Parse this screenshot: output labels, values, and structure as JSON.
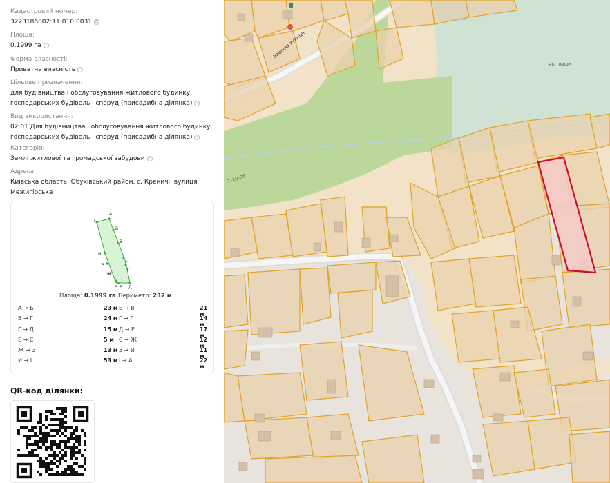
{
  "parcel": {
    "cadastral_label": "Кадастровий номер:",
    "cadastral_value": "3223186802:11:010:0031",
    "area_label": "Площа:",
    "area_value": "0.1999 га",
    "ownership_label": "Форма власності:",
    "ownership_value": "Приватна власність",
    "purpose_label": "Цільове призначення:",
    "purpose_value": "для будівництва і обслуговування житлового будинку, господарських будівель і споруд (присадибна ділянка)",
    "usage_label": "Вид використання:",
    "usage_value": "02.01 Для будівництва і обслуговування житлового будинку, господарських будівель і споруд (присадибна ділянка)",
    "category_label": "Категорія:",
    "category_value": "Землі житлової та громадської забудови",
    "address_label": "Адреса:",
    "address_value": "Київська область, Обухівський район, с. Креничі, вулиця Межигірська"
  },
  "shape_card": {
    "vertex_labels": [
      "А",
      "Б",
      "В",
      "Г",
      "Ґ",
      "Д",
      "Е",
      "Є",
      "Ж",
      "З",
      "И",
      "І"
    ],
    "area_label": "Площа:",
    "area_value": "0.1999 га",
    "perimeter_label": "Периметр:",
    "perimeter_value": "232 м",
    "edges": [
      {
        "a": "А → Б",
        "av": "23 м",
        "b": "Б → В",
        "bv": "21 м"
      },
      {
        "a": "В → Г",
        "av": "24 м",
        "b": "Г → Ґ",
        "bv": "14 м"
      },
      {
        "a": "Ґ → Д",
        "av": "15 м",
        "b": "Д → Е",
        "bv": "17 м"
      },
      {
        "a": "Е → Є",
        "av": "5 м",
        "b": "Є → Ж",
        "bv": "12 м"
      },
      {
        "a": "Ж → З",
        "av": "13 м",
        "b": "З → И",
        "bv": "11 м"
      },
      {
        "a": "И → І",
        "av": "53 м",
        "b": "І → А",
        "bv": "22 м"
      }
    ]
  },
  "qr": {
    "title": "QR-код ділянки:"
  },
  "map": {
    "street_name": "Зарічна вулиця",
    "stream_label": "Річ. вюче",
    "road_label": "Т-10-06",
    "colors": {
      "land": "#f1e2c8",
      "forest": "#bcd79a",
      "meadow": "#cfe2d3",
      "parcel_fill": "#e9d1ac",
      "parcel_stroke": "#e0a327",
      "road": "#e6e6e6",
      "selected_stroke": "#c8102e",
      "selected_fill": "#f6c9c9"
    }
  }
}
